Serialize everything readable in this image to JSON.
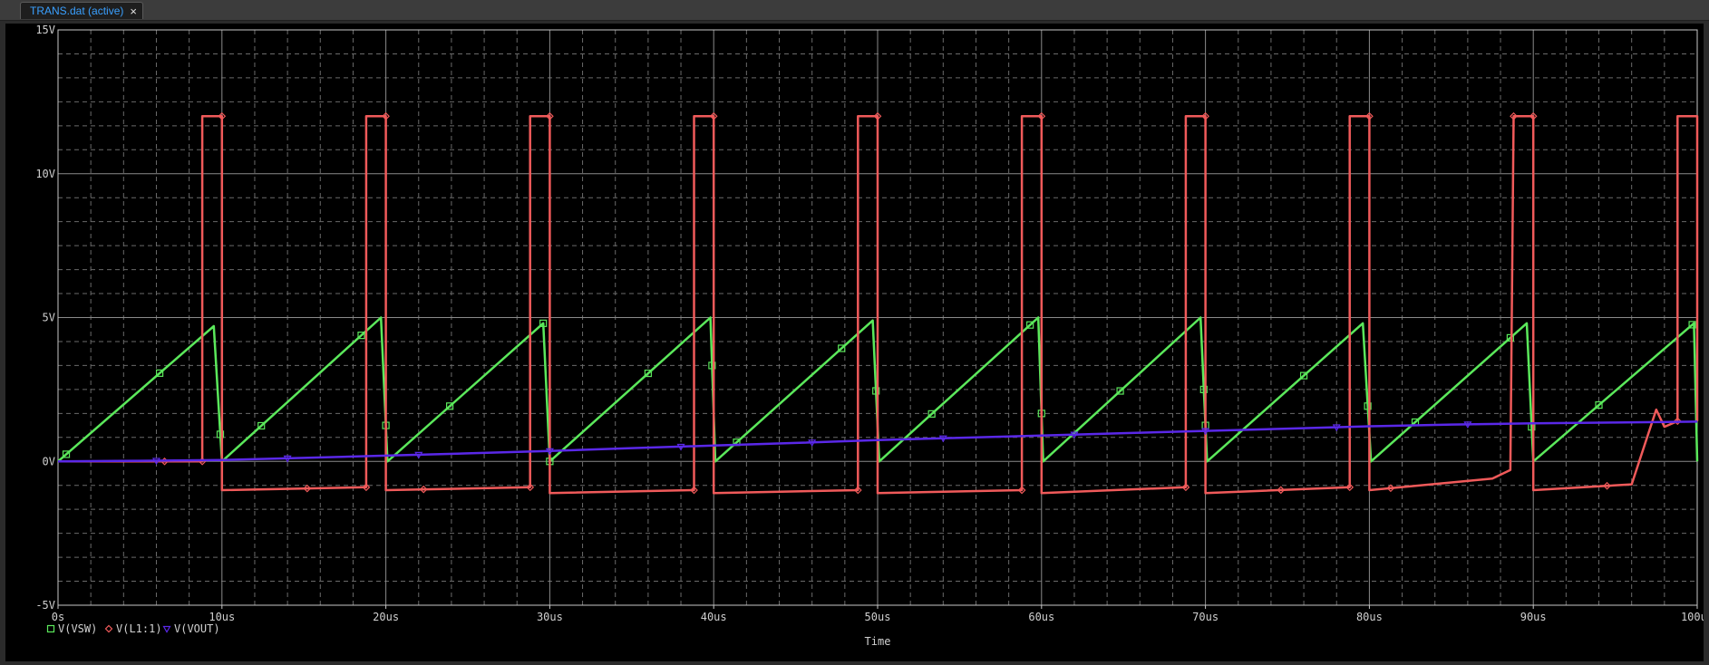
{
  "tab": {
    "title": "TRANS.dat (active)",
    "close_glyph": "×"
  },
  "chart_data": {
    "type": "line",
    "xlabel": "Time",
    "xlim": [
      0,
      100
    ],
    "ylim": [
      -5,
      15
    ],
    "x_unit": "us",
    "xticks": [
      "0s",
      "10us",
      "20us",
      "30us",
      "40us",
      "50us",
      "60us",
      "70us",
      "80us",
      "90us",
      "100us"
    ],
    "yticks": [
      "-5V",
      "0V",
      "5V",
      "10V",
      "15V"
    ],
    "ytick_values": [
      -5,
      0,
      5,
      10,
      15
    ],
    "grid": true,
    "legend_placement": "bottom-left",
    "series": [
      {
        "name": "V(VSW)",
        "color": "#5be85b",
        "marker": "square",
        "points": [
          [
            0,
            0
          ],
          [
            9.5,
            4.7
          ],
          [
            10,
            0
          ],
          [
            19.7,
            5.0
          ],
          [
            20.1,
            0
          ],
          [
            29.6,
            4.8
          ],
          [
            30,
            0
          ],
          [
            39.8,
            5.0
          ],
          [
            40.1,
            0
          ],
          [
            49.7,
            4.9
          ],
          [
            50.1,
            0
          ],
          [
            59.8,
            5.0
          ],
          [
            60.1,
            0
          ],
          [
            69.7,
            5.0
          ],
          [
            70.1,
            0
          ],
          [
            79.6,
            4.8
          ],
          [
            80.1,
            0
          ],
          [
            89.6,
            4.8
          ],
          [
            90,
            0
          ],
          [
            99.8,
            4.8
          ],
          [
            100,
            0
          ]
        ],
        "marker_x": [
          0.5,
          6.2,
          9.9,
          12.4,
          18.5,
          20,
          23.9,
          29.6,
          30,
          36,
          39.9,
          41.4,
          47.8,
          49.9,
          53.3,
          59.3,
          60,
          64.8,
          69.9,
          70,
          76,
          79.9,
          82.8,
          88.6,
          89.9,
          94,
          99.7
        ]
      },
      {
        "name": "V(L1:1)",
        "color": "#f05a5a",
        "marker": "diamond",
        "points": [
          [
            0,
            0
          ],
          [
            8.8,
            0
          ],
          [
            8.8,
            12
          ],
          [
            10,
            12
          ],
          [
            10,
            -1
          ],
          [
            18.8,
            -0.9
          ],
          [
            18.8,
            12
          ],
          [
            20,
            12
          ],
          [
            20,
            -1
          ],
          [
            28.8,
            -0.9
          ],
          [
            28.8,
            12
          ],
          [
            30,
            12
          ],
          [
            30,
            -1.1
          ],
          [
            38.8,
            -1
          ],
          [
            38.8,
            12
          ],
          [
            40,
            12
          ],
          [
            40,
            -1.1
          ],
          [
            48.8,
            -1
          ],
          [
            48.8,
            12
          ],
          [
            50,
            12
          ],
          [
            50,
            -1.1
          ],
          [
            58.8,
            -1
          ],
          [
            58.8,
            12
          ],
          [
            60,
            12
          ],
          [
            60,
            -1.1
          ],
          [
            68.8,
            -0.9
          ],
          [
            68.8,
            12
          ],
          [
            70,
            12
          ],
          [
            70,
            -1.1
          ],
          [
            78.8,
            -0.9
          ],
          [
            78.8,
            12
          ],
          [
            80,
            12
          ],
          [
            80,
            -1
          ],
          [
            87.5,
            -0.6
          ],
          [
            88.6,
            -0.3
          ],
          [
            88.8,
            12
          ],
          [
            90,
            12
          ],
          [
            90,
            -1
          ],
          [
            96,
            -0.8
          ],
          [
            97.5,
            1.8
          ],
          [
            98,
            1.2
          ],
          [
            98.8,
            1.4
          ],
          [
            98.8,
            12
          ],
          [
            100,
            12
          ],
          [
            100,
            1.4
          ]
        ],
        "marker_x": [
          6.5,
          8.8,
          10,
          15.2,
          18.8,
          20,
          22.3,
          28.8,
          30,
          38.8,
          40,
          48.8,
          50,
          58.8,
          60,
          68.8,
          70,
          74.6,
          78.8,
          80,
          81.3,
          88.8,
          90,
          94.5,
          98.8
        ]
      },
      {
        "name": "V(VOUT)",
        "color": "#5a28e8",
        "marker": "triangle-down",
        "points": [
          [
            0,
            0
          ],
          [
            5,
            0.02
          ],
          [
            10,
            0.05
          ],
          [
            15,
            0.12
          ],
          [
            20,
            0.2
          ],
          [
            25,
            0.28
          ],
          [
            30,
            0.36
          ],
          [
            35,
            0.46
          ],
          [
            40,
            0.55
          ],
          [
            45,
            0.64
          ],
          [
            50,
            0.74
          ],
          [
            55,
            0.82
          ],
          [
            60,
            0.9
          ],
          [
            65,
            0.98
          ],
          [
            70,
            1.06
          ],
          [
            75,
            1.14
          ],
          [
            80,
            1.22
          ],
          [
            85,
            1.28
          ],
          [
            90,
            1.32
          ],
          [
            95,
            1.35
          ],
          [
            100,
            1.38
          ]
        ],
        "marker_x": [
          6,
          14,
          22,
          30,
          38,
          46,
          54,
          62,
          70,
          78,
          86
        ]
      }
    ]
  }
}
